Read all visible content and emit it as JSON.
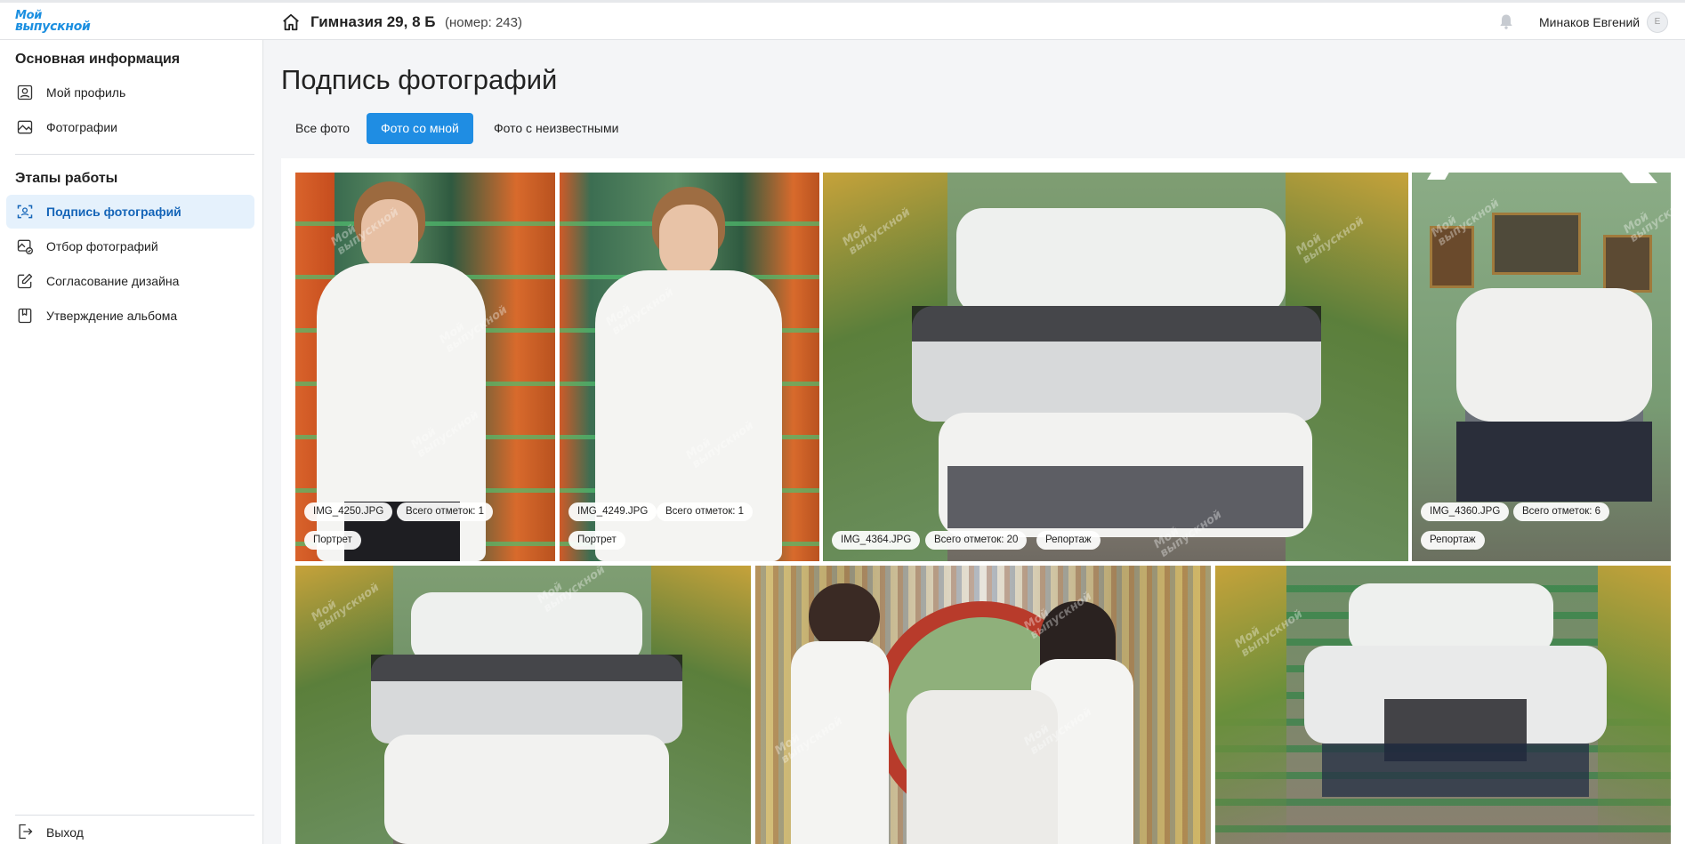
{
  "header": {
    "logo_line1": "Мой",
    "logo_line2": "выпускной",
    "school": "Гимназия 29, 8 Б",
    "school_number": "(номер: 243)",
    "user_name": "Минаков Евгений",
    "avatar_letter": "Е"
  },
  "sidebar": {
    "section1": "Основная информация",
    "section2": "Этапы работы",
    "items": [
      {
        "label": "Мой профиль",
        "icon": "user-icon"
      },
      {
        "label": "Фотографии",
        "icon": "image-icon"
      },
      {
        "label": "Подпись фотографий",
        "icon": "face-scan-icon",
        "active": true
      },
      {
        "label": "Отбор фотографий",
        "icon": "select-image-icon"
      },
      {
        "label": "Согласование дизайна",
        "icon": "edit-icon"
      },
      {
        "label": "Утверждение альбома",
        "icon": "album-icon"
      }
    ],
    "logout": "Выход"
  },
  "main": {
    "title": "Подпись фотографий",
    "tabs": [
      "Все фото",
      "Фото со мной",
      "Фото с неизвестными"
    ],
    "active_tab": 1
  },
  "photos": [
    {
      "file": "IMG_4250.JPG",
      "marks": "Всего отметок: 1",
      "tag": "Портрет"
    },
    {
      "file": "IMG_4249.JPG",
      "marks": "Всего отметок: 1",
      "tag": "Портрет"
    },
    {
      "file": "IMG_4364.JPG",
      "marks": "Всего отметок: 20",
      "tag": "Репортаж"
    },
    {
      "file": "IMG_4360.JPG",
      "marks": "Всего отметок: 6",
      "tag": "Репортаж"
    }
  ],
  "watermark": [
    "Мой",
    "выпускной"
  ],
  "colors": {
    "accent": "#1f8de3",
    "active_bg": "#e5f1fc",
    "active_text": "#1565b8"
  }
}
